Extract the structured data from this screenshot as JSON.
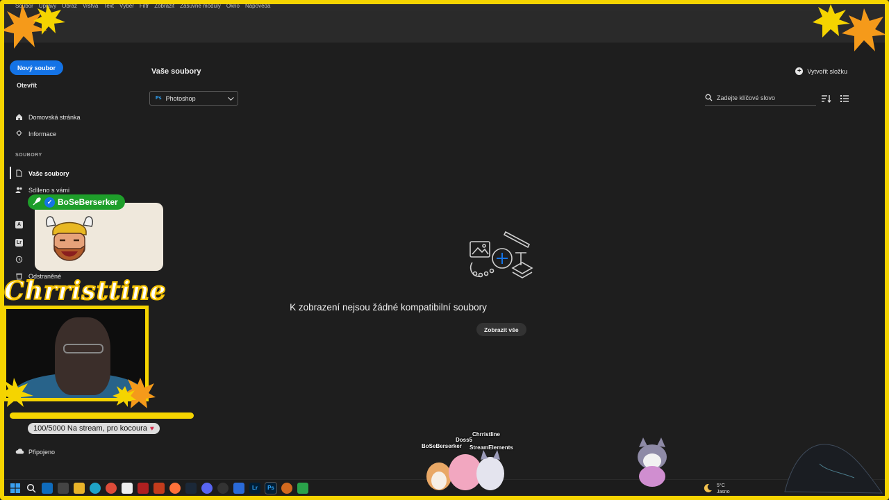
{
  "menubar": {
    "items": [
      "Soubor",
      "Úpravy",
      "Obraz",
      "Vrstva",
      "Text",
      "Výběr",
      "Filtr",
      "Zobrazit",
      "Zásuvné moduly",
      "Okno",
      "Nápověda"
    ]
  },
  "sidebar": {
    "new_file": "Nový soubor",
    "open": "Otevřít",
    "home": "Domovská stránka",
    "info": "Informace",
    "section_files": "SOUBORY",
    "your_files": "Vaše soubory",
    "shared": "Sdíleno s vámi",
    "deleted": "Odstraněné",
    "connected": "Připojeno"
  },
  "main": {
    "title": "Vaše soubory",
    "create_folder": "Vytvořit složku",
    "app_filter": "Photoshop",
    "app_badge": "Ps",
    "search_placeholder": "Zadejte klíčové slovo",
    "empty_message": "K zobrazení nejsou žádné kompatibilní soubory",
    "show_all": "Zobrazit vše"
  },
  "overlay": {
    "streamer_name": "BoSeBerserker",
    "cam_title": "Chrristtine",
    "goal_text": "100/5000 Na stream, pro kocoura",
    "goal_progress": 0.02,
    "pets": [
      "BoSeBerserker",
      "Doss5",
      "Chrristline",
      "StreamElements"
    ]
  },
  "weather": {
    "temp": "5°C",
    "condition": "Jasno"
  },
  "taskbar": {
    "lr": "Lr",
    "ps": "Ps"
  },
  "colors": {
    "accent": "#1473e6",
    "frame": "#f5d400",
    "ps_blue": "#31a8ff",
    "badge_green": "#1e9e2a"
  }
}
